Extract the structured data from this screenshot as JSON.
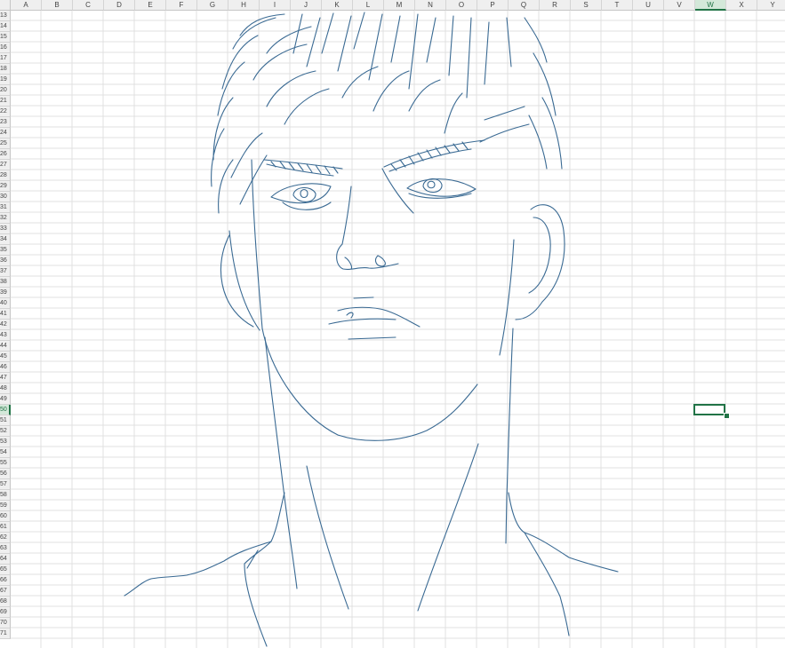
{
  "sheet": {
    "columns": [
      "A",
      "B",
      "C",
      "D",
      "E",
      "F",
      "G",
      "H",
      "I",
      "J",
      "K",
      "L",
      "M",
      "N",
      "O",
      "P",
      "Q",
      "R",
      "S",
      "T",
      "U",
      "V",
      "W",
      "X",
      "Y"
    ],
    "rows": [
      "13",
      "14",
      "15",
      "16",
      "17",
      "18",
      "19",
      "20",
      "21",
      "22",
      "23",
      "24",
      "25",
      "26",
      "27",
      "28",
      "29",
      "30",
      "31",
      "32",
      "33",
      "34",
      "35",
      "36",
      "37",
      "38",
      "39",
      "40",
      "41",
      "42",
      "43",
      "44",
      "45",
      "46",
      "47",
      "48",
      "49",
      "50",
      "51",
      "52",
      "53",
      "54",
      "55",
      "56",
      "57",
      "58",
      "59",
      "60",
      "61",
      "62",
      "63",
      "64",
      "65",
      "66",
      "67",
      "68",
      "69",
      "70",
      "71"
    ],
    "selected_column": "W",
    "selected_row": "50",
    "active_cell": "W50"
  },
  "drawing": {
    "description_icon": "line-art-portrait",
    "stroke_color": "#3a6a93"
  },
  "colors": {
    "grid_line": "#e1e1e1",
    "header_bg": "#efefef",
    "selection": "#217346"
  }
}
